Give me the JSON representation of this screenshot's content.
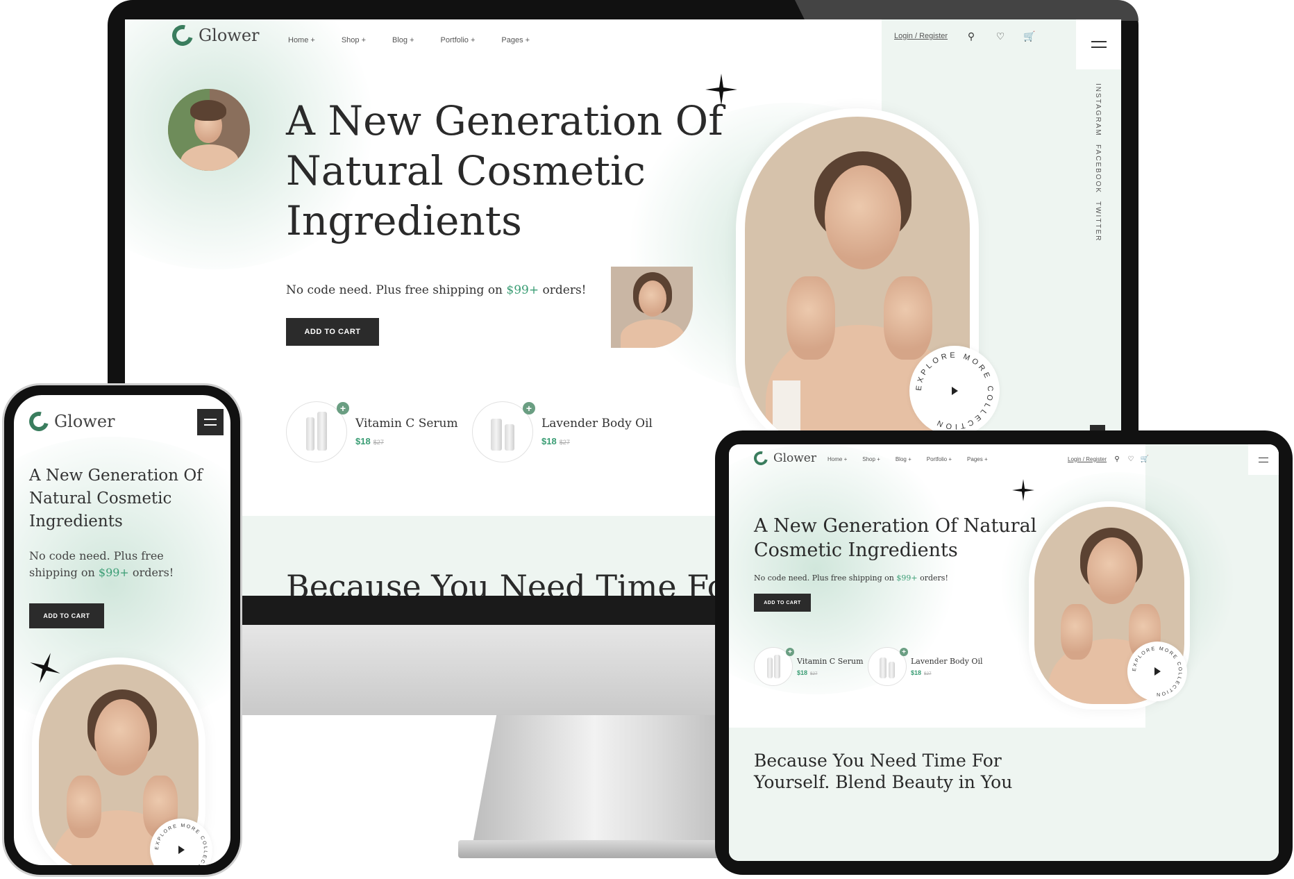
{
  "site": {
    "brand": "Glower",
    "nav": [
      "Home",
      "Shop",
      "Blog",
      "Portfolio",
      "Pages"
    ],
    "login": "Login / Register",
    "hero_title": "A New Generation Of Natural Cosmetic Ingredients",
    "hero_title_lines": [
      "A New Generation Of",
      "Natural Cosmetic",
      "Ingredients"
    ],
    "tablet_title_lines": [
      "A New Generation Of Natural",
      "Cosmetic Ingredients"
    ],
    "subtitle_pre": "No code need. Plus free shipping on ",
    "subtitle_price": "$99+",
    "subtitle_post": " orders!",
    "cta": "ADD TO CART",
    "social": [
      "INSTAGRAM",
      "FACEBOOK",
      "TWITTER"
    ],
    "explore_text": "EXPLORE MORE COLLECTION",
    "products": [
      {
        "name": "Vitamin C Serum",
        "price": "$18",
        "old_price": "$27"
      },
      {
        "name": "Lavender Body Oil",
        "price": "$18",
        "old_price": "$27"
      }
    ],
    "section2_monitor": "Because You Need Time For",
    "section2_lines": [
      "Because You Need Time For",
      "Yourself. Blend Beauty in You"
    ]
  },
  "colors": {
    "accent": "#3a9d74",
    "logo": "#3a7d5e",
    "button": "#2b2b2b",
    "mint": "#eaf2ee",
    "device": "#111111"
  },
  "icons": [
    "logo-leaf-icon",
    "search-icon",
    "heart-icon",
    "cart-icon",
    "menu-icon",
    "plus-icon",
    "play-icon",
    "sparkle-star-icon"
  ]
}
